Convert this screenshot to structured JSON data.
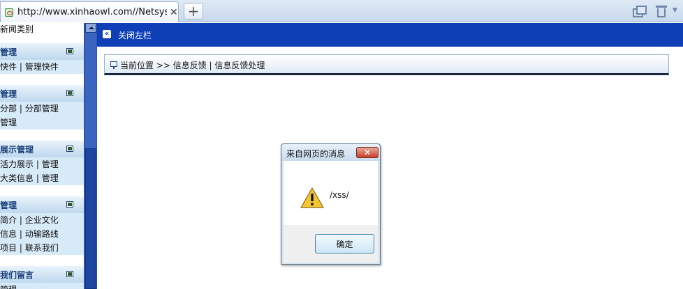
{
  "browser": {
    "tab_title": "http://www.xinhaowl.com//Netsys...",
    "tab_close": "✕",
    "new_tab": "+"
  },
  "sidebar": {
    "top_text": "新闻类别",
    "groups": [
      {
        "title": "管理",
        "lines": [
          [
            "快件",
            "管理快件"
          ]
        ]
      },
      {
        "title": "管理",
        "lines": [
          [
            "分部",
            "分部管理"
          ],
          [
            "管理"
          ]
        ]
      },
      {
        "title": "展示管理",
        "lines": [
          [
            "活力展示",
            "管理"
          ],
          [
            "大类信息",
            "管理"
          ]
        ]
      },
      {
        "title": "管理",
        "lines": [
          [
            "简介",
            "企业文化"
          ],
          [
            "信息",
            "动输路线"
          ],
          [
            "项目",
            "联系我们"
          ]
        ]
      },
      {
        "title": "我们留言",
        "lines": [
          [
            "管理"
          ]
        ]
      }
    ]
  },
  "topbar": {
    "collapse_label": "关闭左栏"
  },
  "breadcrumb": {
    "text": "当前位置 >> 信息反馈 | 信息反馈处理"
  },
  "dialog": {
    "title": "来自网页的消息",
    "close": "✕",
    "message": "/xss/",
    "ok_label": "确定"
  }
}
